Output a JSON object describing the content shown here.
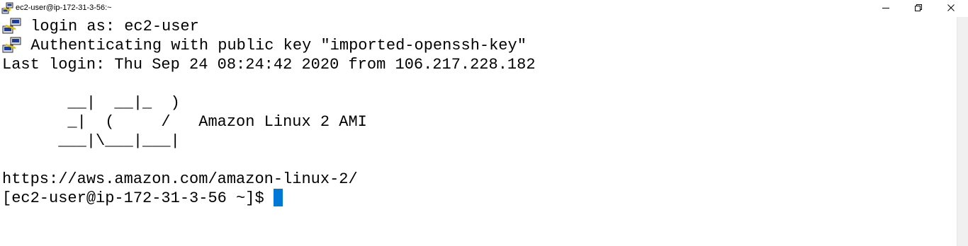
{
  "window": {
    "title": "ec2-user@ip-172-31-3-56:~",
    "icon": "putty-icon",
    "controls": {
      "minimize_icon": "minimize-icon",
      "maximize_icon": "restore-icon",
      "close_icon": "close-icon"
    }
  },
  "terminal": {
    "line1": " login as: ec2-user",
    "line2": " Authenticating with public key \"imported-openssh-key\"",
    "line3": "Last login: Thu Sep 24 08:24:42 2020 from 106.217.228.182",
    "banner1": "       __|  __|_  )",
    "banner2": "       _|  (     /   Amazon Linux 2 AMI",
    "banner3": "      ___|\\___|___|",
    "url": "https://aws.amazon.com/amazon-linux-2/",
    "prompt": "[ec2-user@ip-172-31-3-56 ~]$ ",
    "cursor_color": "#0078d7"
  }
}
